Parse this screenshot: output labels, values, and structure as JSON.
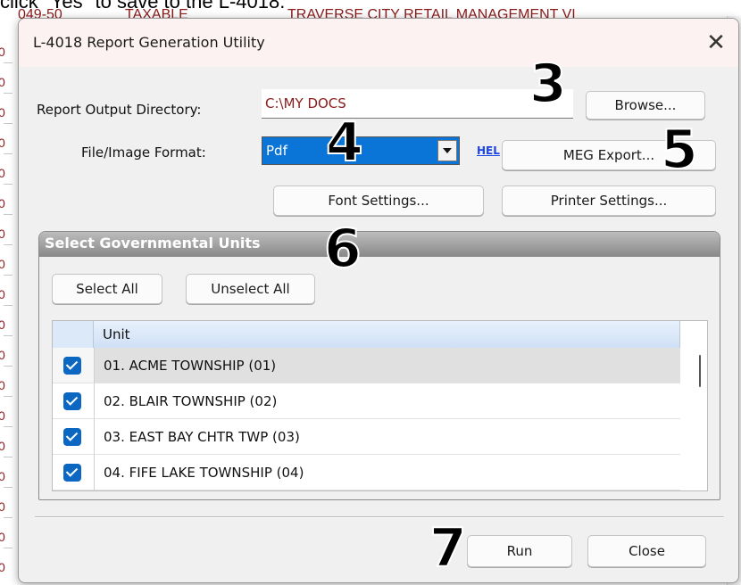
{
  "background": {
    "caption": "click \"Yes\" to save to the L-4018.",
    "row_cells": [
      "049-50",
      "TAXABLE",
      "TRAVERSE CITY RETAIL MANAGEMENT VI"
    ],
    "side_marks": [
      "0",
      "0",
      "0",
      "0",
      "0",
      "0",
      "0",
      "0",
      "0",
      "0",
      "0",
      "0",
      "0",
      "0",
      "0",
      "0",
      "0",
      "0"
    ]
  },
  "dialog": {
    "title": "L-4018 Report Generation Utility",
    "close_glyph": "✕",
    "output_dir": {
      "label": "Report Output Directory:",
      "value": "C:\\MY DOCS",
      "browse_label": "Browse..."
    },
    "format": {
      "label": "File/Image Format:",
      "value": "Pdf",
      "help_link": "HEL",
      "meg_label": "MEG Export..."
    },
    "font_settings_label": "Font Settings...",
    "printer_settings_label": "Printer Settings...",
    "units_group": {
      "title": "Select Governmental Units",
      "select_all_label": "Select All",
      "unselect_all_label": "Unselect All",
      "column_header": "Unit",
      "rows": [
        {
          "name": "01. ACME TOWNSHIP (01)",
          "checked": true,
          "selected": true
        },
        {
          "name": "02. BLAIR TOWNSHIP (02)",
          "checked": true,
          "selected": false
        },
        {
          "name": "03. EAST BAY CHTR TWP (03)",
          "checked": true,
          "selected": false
        },
        {
          "name": "04. FIFE LAKE TOWNSHIP (04)",
          "checked": true,
          "selected": false
        }
      ]
    },
    "run_label": "Run",
    "close_label": "Close"
  },
  "step_badges": [
    "3",
    "4",
    "5",
    "6",
    "7"
  ],
  "colors": {
    "accent": "#0b74d7",
    "path_text": "#8b1a1a",
    "link": "#1a44e6",
    "checkbox": "#0b67c2"
  }
}
